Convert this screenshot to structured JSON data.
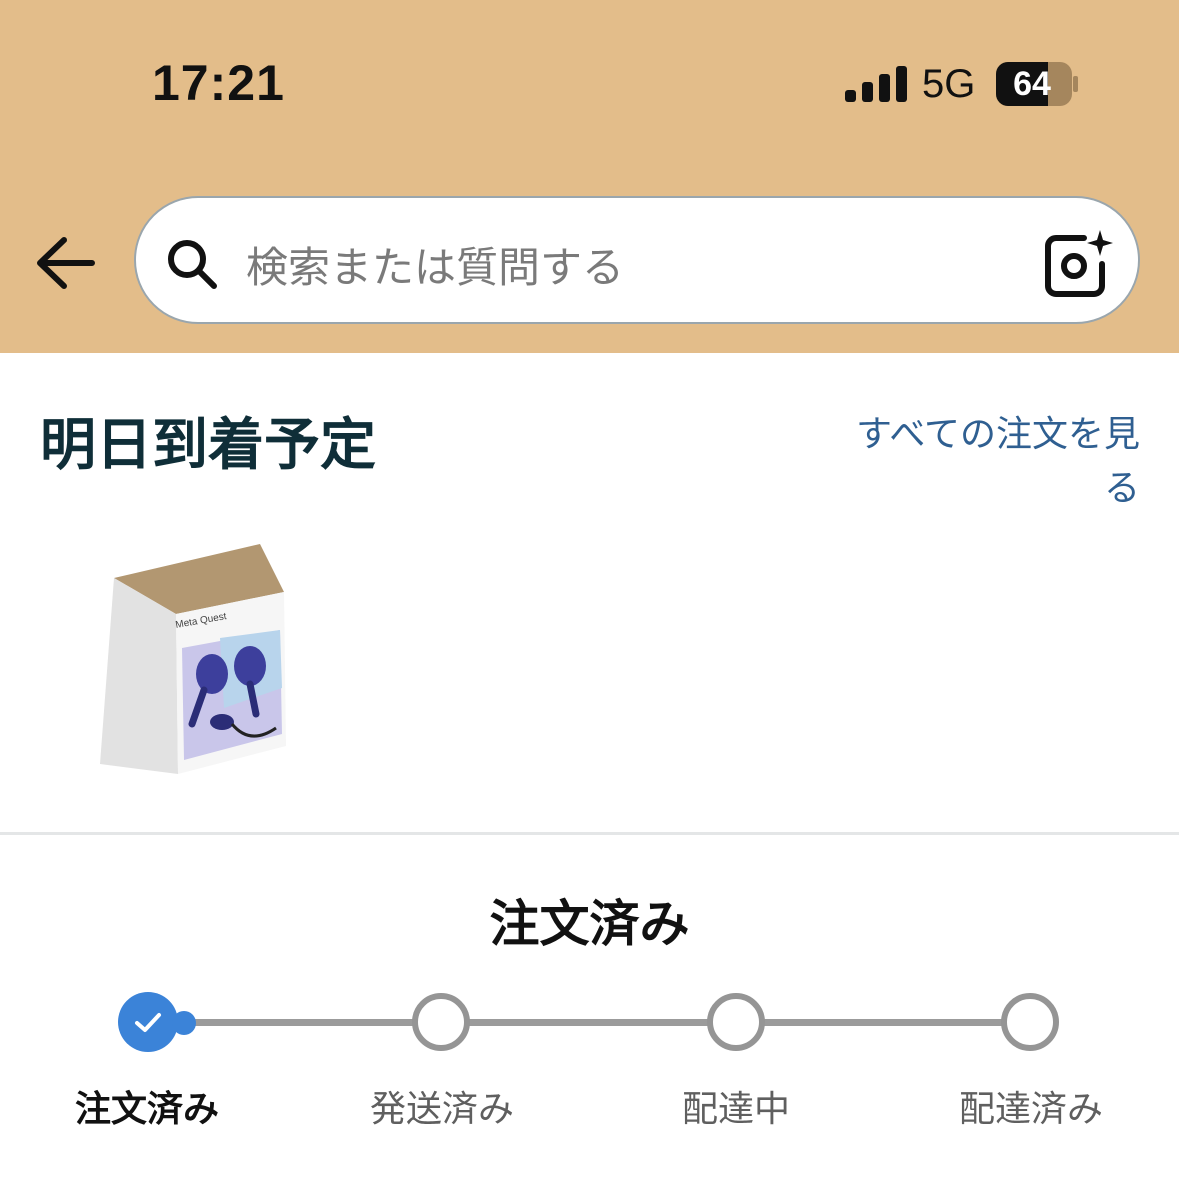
{
  "colors": {
    "header_bg": "#e3bd8a",
    "title_text": "#0f2e38",
    "link": "#2f5f91",
    "progress_active": "#3b83d8",
    "progress_inactive": "#959595"
  },
  "status_bar": {
    "time": "17:21",
    "network": "5G",
    "battery": "64"
  },
  "search": {
    "placeholder": "検索または質問する"
  },
  "section": {
    "title": "明日到着予定",
    "see_all_link": "すべての注文を見る"
  },
  "product": {
    "brand_text": "Meta Quest"
  },
  "order_status": {
    "title": "注文済み",
    "progress": 0.0,
    "steps": [
      {
        "label": "注文済み",
        "done": true
      },
      {
        "label": "発送済み",
        "done": false
      },
      {
        "label": "配達中",
        "done": false
      },
      {
        "label": "配達済み",
        "done": false
      }
    ]
  }
}
